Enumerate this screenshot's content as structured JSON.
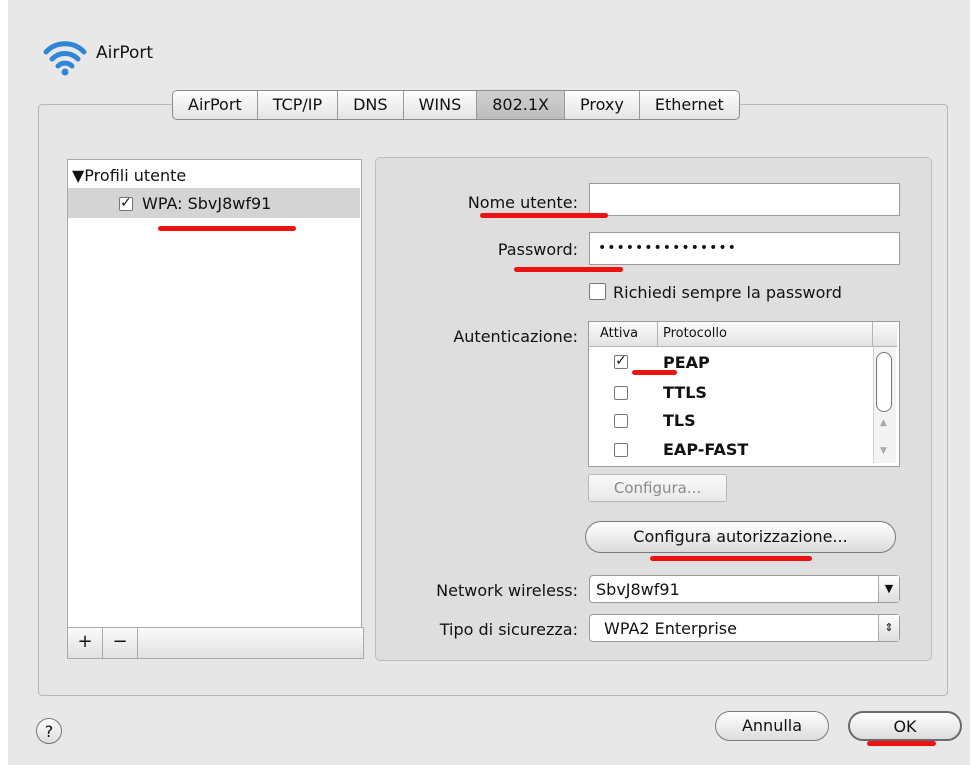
{
  "window": {
    "title": "AirPort"
  },
  "tabs": [
    {
      "label": "AirPort"
    },
    {
      "label": "TCP/IP"
    },
    {
      "label": "DNS"
    },
    {
      "label": "WINS"
    },
    {
      "label": "802.1X",
      "active": true
    },
    {
      "label": "Proxy"
    },
    {
      "label": "Ethernet"
    }
  ],
  "profiles": {
    "header": "▼Profili utente",
    "selected_item": "WPA: SbvJ8wf91",
    "selected_checked": true,
    "add_label": "+",
    "remove_label": "−"
  },
  "form": {
    "username_label": "Nome utente:",
    "username_value": "",
    "password_label": "Password:",
    "password_value": "•••••••••••••••",
    "always_ask_label": "Richiedi sempre la password",
    "always_ask_checked": false,
    "auth_label": "Autenticazione:",
    "auth_columns": [
      "Attiva",
      "Protocollo"
    ],
    "auth_protocols": [
      {
        "name": "PEAP",
        "active": true
      },
      {
        "name": "TTLS",
        "active": false
      },
      {
        "name": "TLS",
        "active": false
      },
      {
        "name": "EAP-FAST",
        "active": false
      }
    ],
    "configure_label": "Configura...",
    "configure_trust_label": "Configura autorizzazione...",
    "wireless_label": "Network wireless:",
    "wireless_value": "SbvJ8wf91",
    "security_label": "Tipo di sicurezza:",
    "security_value": "WPA2 Enterprise"
  },
  "footer": {
    "help_label": "?",
    "cancel_label": "Annulla",
    "ok_label": "OK"
  },
  "colors": {
    "annotation_red": "#ee1111",
    "selection": "#d4d4d4"
  }
}
